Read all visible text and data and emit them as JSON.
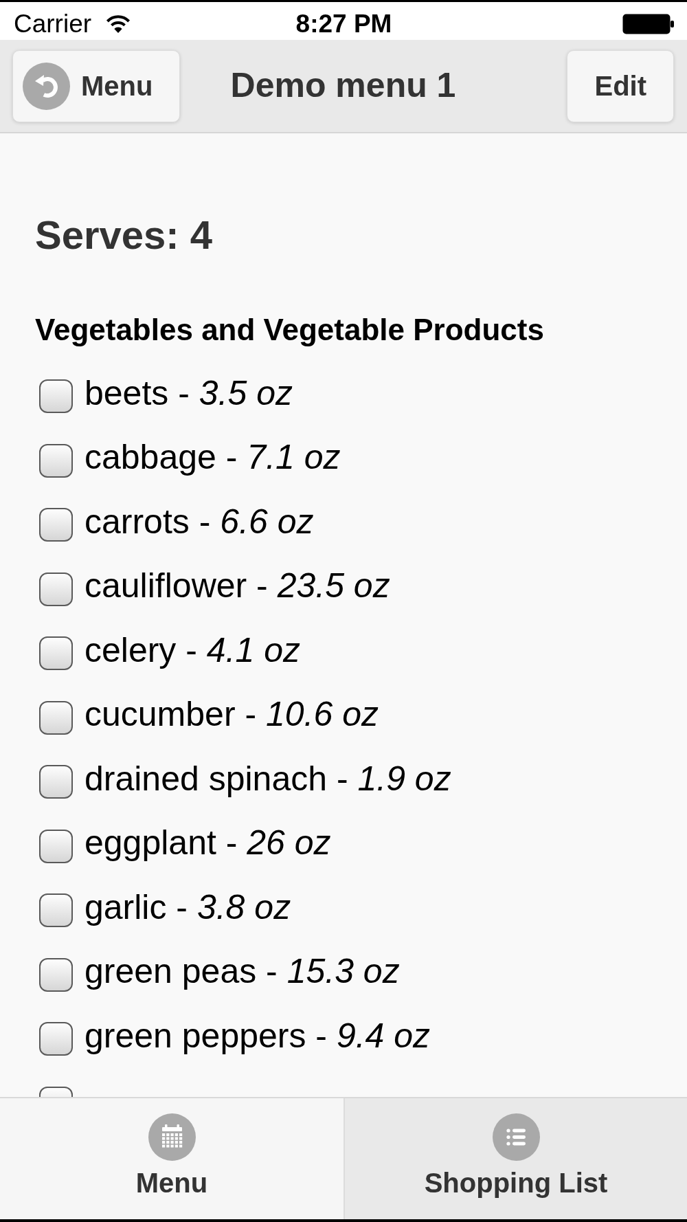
{
  "status_bar": {
    "carrier": "Carrier",
    "time": "8:27 PM"
  },
  "header": {
    "back_button": "Menu",
    "title": "Demo menu 1",
    "edit_button": "Edit"
  },
  "content": {
    "serves": "Serves: 4",
    "category": "Vegetables and Vegetable Products",
    "items": [
      {
        "label": "beets - *3.5 oz*",
        "checked": false
      },
      {
        "label": "cabbage - *7.1 oz*",
        "checked": false
      },
      {
        "label": "carrots - *6.6 oz*",
        "checked": false
      },
      {
        "label": "cauliflower - *23.5 oz*",
        "checked": false
      },
      {
        "label": "celery - *4.1 oz*",
        "checked": false
      },
      {
        "label": "cucumber - *10.6 oz*",
        "checked": false
      },
      {
        "label": "drained spinach - *1.9 oz*",
        "checked": false
      },
      {
        "label": "eggplant - *26 oz*",
        "checked": false
      },
      {
        "label": "garlic - *3.8 oz*",
        "checked": false
      },
      {
        "label": "green peas - *15.3 oz*",
        "checked": false
      },
      {
        "label": "green peppers - *9.4 oz*",
        "checked": false
      },
      {
        "checked": false
      }
    ]
  },
  "tabs": [
    {
      "label": "Menu",
      "kind": "calendar",
      "selected": false
    },
    {
      "label": "Shopping List",
      "kind": "list",
      "selected": true
    }
  ]
}
